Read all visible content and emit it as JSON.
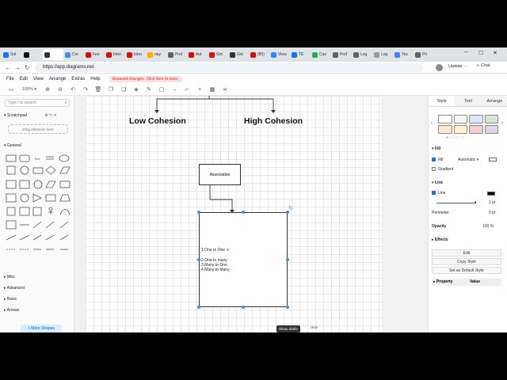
{
  "browser": {
    "tabs": [
      {
        "label": "Sol",
        "color": "#1a73e8"
      },
      {
        "label": "",
        "color": "#000000"
      },
      {
        "label": "",
        "color": "#333333",
        "active": true
      },
      {
        "label": "Cor",
        "color": "#4a90d9"
      },
      {
        "label": "Fee",
        "color": "#c71610"
      },
      {
        "label": "Inbo",
        "color": "#c71610"
      },
      {
        "label": "Inbo",
        "color": "#c71610"
      },
      {
        "label": "nay",
        "color": "#ffb000"
      },
      {
        "label": "Prof",
        "color": "#5f6368"
      },
      {
        "label": "Aut",
        "color": "#c71610"
      },
      {
        "label": "Gm",
        "color": "#c71610"
      },
      {
        "label": "Gm",
        "color": "#333333"
      },
      {
        "label": "(85)",
        "color": "#c71610"
      },
      {
        "label": "View",
        "color": "#4285f4"
      },
      {
        "label": "TE",
        "color": "#1a73e8"
      },
      {
        "label": "Cas",
        "color": "#34a853"
      },
      {
        "label": "Prof",
        "color": "#5f6368"
      },
      {
        "label": "Log",
        "color": "#5f6368"
      },
      {
        "label": "Log",
        "color": "#999999"
      },
      {
        "label": "Tes",
        "color": "#4285f4"
      },
      {
        "label": "Pri",
        "color": "#5f6368"
      }
    ],
    "url": "https://app.diagrams.net",
    "update_label": "Update",
    "chat_label": "Chat"
  },
  "menu": {
    "items": [
      "File",
      "Edit",
      "View",
      "Arrange",
      "Extras",
      "Help"
    ],
    "unsaved": "Unsaved changes. Click here to save."
  },
  "toolbar": {
    "zoom": "100%"
  },
  "sidebar": {
    "search_placeholder": "Type / to search",
    "scratchpad": "Scratchpad",
    "drag_hint": "Drag elements here",
    "general": "General",
    "sections": [
      "Misc",
      "Advanced",
      "Basic",
      "Arrows"
    ],
    "more_shapes": "+ More Shapes"
  },
  "diagram": {
    "left_title": "Low Cohesion",
    "right_title": "High Cohesion",
    "association": "Association",
    "lines": [
      "1.One to One",
      "2.One to many",
      "3.Many to One",
      "4.Many to Many"
    ],
    "draft_button": "Show drafts",
    "draft_hint": "Hide"
  },
  "panel": {
    "tabs": [
      "Style",
      "Text",
      "Arrange"
    ],
    "swatches": [
      "#ffffff",
      "#f5f5f5",
      "#dae8fc",
      "#d5e8d4",
      "#ffe6cc",
      "#fff2cc",
      "#f8cecc",
      "#e1d5e7"
    ],
    "fill_section": "Fill",
    "fill_label": "Fill",
    "fill_value": "Automatic",
    "gradient_label": "Gradient",
    "line_section": "Line",
    "line_label": "Line",
    "line_width": "1 pt",
    "perimeter_label": "Perimeter",
    "perimeter_value": "0 pt",
    "opacity_label": "Opacity",
    "opacity_value": "100 %",
    "effects_label": "Effects",
    "edit_button": "Edit",
    "copy_style": "Copy Style",
    "default_style": "Set as Default Style",
    "property_label": "Property",
    "value_label": "Value"
  }
}
